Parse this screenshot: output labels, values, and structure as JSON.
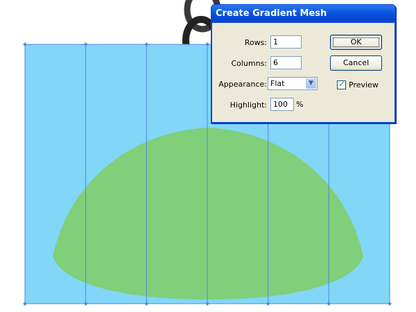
{
  "colors": {
    "canvas_bg": "#ffffff",
    "mesh_fill": "#82d6f8",
    "mesh_line": "#4f86e6",
    "hill_fill": "#80cf7a",
    "titlebar_blue": "#0a55e0",
    "dialog_bg": "#ece9d8"
  },
  "artwork": {
    "mesh_rows": 1,
    "mesh_columns": 6,
    "chain_icon": "chain-link-icon"
  },
  "dialog": {
    "title": "Create Gradient Mesh",
    "rows_label": "Rows:",
    "rows_value": "1",
    "columns_label": "Columns:",
    "columns_value": "6",
    "appearance_label": "Appearance:",
    "appearance_value": "Flat",
    "highlight_label": "Highlight:",
    "highlight_value": "100",
    "highlight_unit": "%",
    "ok_label": "OK",
    "cancel_label": "Cancel",
    "preview_label": "Preview",
    "preview_checked": true
  }
}
